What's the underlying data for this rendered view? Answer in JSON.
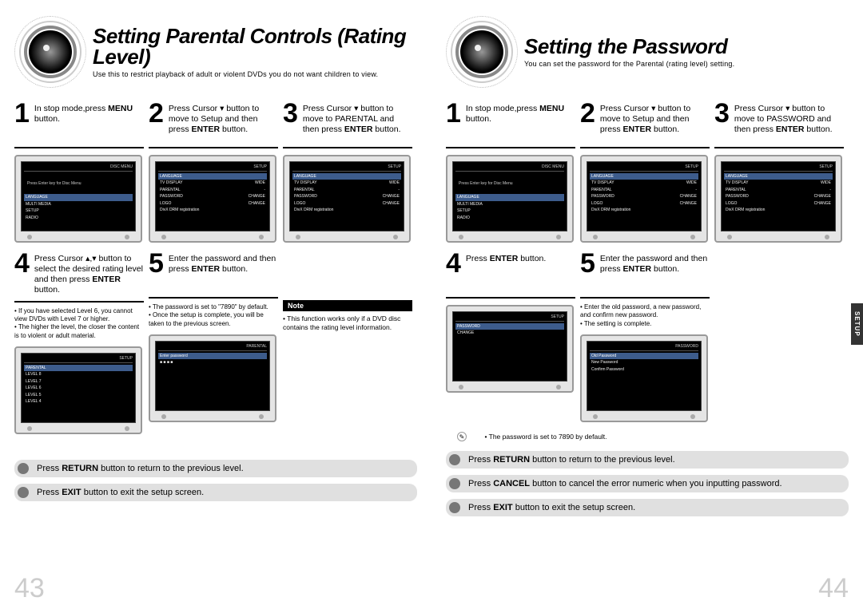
{
  "left": {
    "title": "Setting Parental Controls (Rating Level)",
    "subtitle": "Use this to restrict playback of adult or violent DVDs you do not want children to view.",
    "steps": [
      {
        "num": "1",
        "text": "In stop mode,press <b>MENU</b> button."
      },
      {
        "num": "2",
        "text": "Press Cursor ▾ button to move to Setup and then press <b>ENTER</b> button."
      },
      {
        "num": "3",
        "text": "Press Cursor ▾ button to move to PARENTAL and then press <b>ENTER</b> button."
      },
      {
        "num": "4",
        "text": "Press Cursor ▴,▾ button to select the desired rating level and then press <b>ENTER</b> button.",
        "notes": [
          "If you have selected Level 6, you cannot view DVDs with Level 7 or higher.",
          "The higher the level, the closer the content is to violent or adult material."
        ]
      },
      {
        "num": "5",
        "text": "Enter the password and then press <b>ENTER</b> button.",
        "notes": [
          "The password is set to \"7890\" by default.",
          "Once the setup is complete, you will be taken to the previous screen."
        ]
      }
    ],
    "note_label": "Note",
    "note_body": "• This function works only if a DVD disc contains the rating level information.",
    "bullets": [
      "Press <b>RETURN</b> button to return to the previous level.",
      "Press <b>EXIT</b> button to exit the setup screen."
    ],
    "pagenum": "43",
    "screen1": {
      "title": "DISC MENU",
      "rows": [
        [
          "LANGUAGE",
          ""
        ],
        [
          "MULTI MEDIA",
          ""
        ],
        [
          "SETUP",
          ""
        ],
        [
          "RADIO",
          ""
        ]
      ],
      "hint": "Press Enter key for Disc Menu"
    },
    "screen2": {
      "title": "SETUP",
      "rows": [
        [
          "LANGUAGE",
          ""
        ],
        [
          "TV DISPLAY",
          "WIDE"
        ],
        [
          "PARENTAL",
          "-"
        ],
        [
          "PASSWORD",
          "CHANGE"
        ],
        [
          "LOGO",
          "CHANGE"
        ],
        [
          "DivX DRM registration",
          ""
        ]
      ]
    },
    "screen3": {
      "title": "SETUP",
      "rows": [
        [
          "LANGUAGE",
          ""
        ],
        [
          "TV DISPLAY",
          "WIDE"
        ],
        [
          "PARENTAL",
          "-"
        ],
        [
          "PASSWORD",
          "CHANGE"
        ],
        [
          "LOGO",
          "CHANGE"
        ],
        [
          "DivX DRM registration",
          ""
        ]
      ]
    },
    "screen4": {
      "title": "SETUP",
      "rows": [
        [
          "PARENTAL",
          ""
        ],
        [
          "LEVEL 8",
          ""
        ],
        [
          "LEVEL 7",
          ""
        ],
        [
          "LEVEL 6",
          ""
        ],
        [
          "LEVEL 5",
          ""
        ],
        [
          "LEVEL 4",
          ""
        ]
      ]
    },
    "screen5": {
      "title": "PARENTAL",
      "rows": [
        [
          "Enter password",
          ""
        ],
        [
          "■ ■ ■ ■",
          ""
        ]
      ]
    }
  },
  "right": {
    "title": "Setting the Password",
    "subtitle": "You can set the password for the Parental (rating level) setting.",
    "steps": [
      {
        "num": "1",
        "text": "In stop mode,press <b>MENU</b> button."
      },
      {
        "num": "2",
        "text": "Press Cursor ▾ button to move to Setup and then press <b>ENTER</b> button."
      },
      {
        "num": "3",
        "text": "Press Cursor ▾ button to move to PASSWORD and then press <b>ENTER</b> button."
      },
      {
        "num": "4",
        "text": "Press <b>ENTER</b> button."
      },
      {
        "num": "5",
        "text": "Enter the password and then press <b>ENTER</b> button.",
        "notes": [
          "Enter the old password, a new password, and confirm new password.",
          "The setting is complete."
        ]
      }
    ],
    "footnote": "• The password is set to 7890 by default.",
    "bullets": [
      "Press <b>RETURN</b> button to return to the previous level.",
      "Press <b>CANCEL</b> button to cancel the error numeric when you inputting password.",
      "Press <b>EXIT</b> button to exit the setup screen."
    ],
    "pagenum": "44",
    "side_tab": "SETUP",
    "screen1": {
      "title": "DISC MENU",
      "rows": [
        [
          "LANGUAGE",
          ""
        ],
        [
          "MULTI MEDIA",
          ""
        ],
        [
          "SETUP",
          ""
        ],
        [
          "RADIO",
          ""
        ]
      ],
      "hint": "Press Enter key for Disc Menu"
    },
    "screen2": {
      "title": "SETUP",
      "rows": [
        [
          "LANGUAGE",
          ""
        ],
        [
          "TV DISPLAY",
          "WIDE"
        ],
        [
          "PARENTAL",
          "-"
        ],
        [
          "PASSWORD",
          "CHANGE"
        ],
        [
          "LOGO",
          "CHANGE"
        ],
        [
          "DivX DRM registration",
          ""
        ]
      ]
    },
    "screen3": {
      "title": "SETUP",
      "rows": [
        [
          "LANGUAGE",
          ""
        ],
        [
          "TV DISPLAY",
          "WIDE"
        ],
        [
          "PARENTAL",
          "-"
        ],
        [
          "PASSWORD",
          "CHANGE"
        ],
        [
          "LOGO",
          "CHANGE"
        ],
        [
          "DivX DRM registration",
          ""
        ]
      ]
    },
    "screen4": {
      "title": "SETUP",
      "rows": [
        [
          "PASSWORD",
          ""
        ],
        [
          "CHANGE",
          ""
        ]
      ]
    },
    "screen5": {
      "title": "PASSWORD",
      "rows": [
        [
          "Old Password",
          ""
        ],
        [
          "New Password",
          ""
        ],
        [
          "Confirm Password",
          ""
        ]
      ]
    }
  }
}
